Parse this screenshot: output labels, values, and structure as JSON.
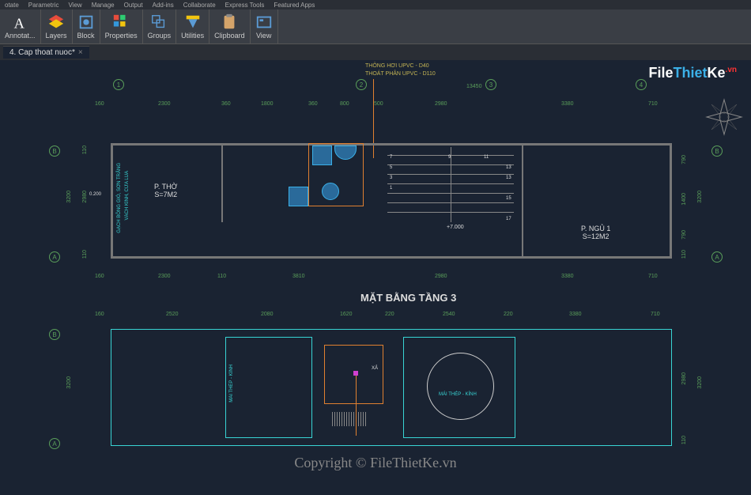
{
  "ribbon_tabs": [
    "otate",
    "Parametric",
    "View",
    "Manage",
    "Output",
    "Add-ins",
    "Collaborate",
    "Express Tools",
    "Featured Apps"
  ],
  "ribbon": {
    "annotate": "Annotat...",
    "layers": "Layers",
    "block": "Block",
    "properties": "Properties",
    "groups": "Groups",
    "utilities": "Utilities",
    "clipboard": "Clipboard",
    "view": "View"
  },
  "tab": {
    "name": "4. Cap thoat nuoc*"
  },
  "logo": {
    "file": "File",
    "thiet": "Thiet",
    "ke": "Ke",
    "vn": ".vn"
  },
  "watermark": "Copyright © FileThietKe.vn",
  "plan": {
    "header1": "THÔNG HƠI UPVC - D40",
    "header2": "THOÁT PHÂN UPVC - D110",
    "title": "MẶT BẰNG TẦNG 3",
    "grid_cols": [
      "1",
      "2",
      "3",
      "4"
    ],
    "grid_rows": [
      "B",
      "A"
    ],
    "dims_top_total": "13450",
    "dims_top": [
      "160",
      "2300",
      "360",
      "1800",
      "360",
      "800",
      "500",
      "2980",
      "3380",
      "710"
    ],
    "dims_left": [
      "110",
      "2980",
      "110",
      "3200"
    ],
    "dims_right": [
      "790",
      "1400",
      "790",
      "110",
      "3200"
    ],
    "dims_bottom": [
      "160",
      "2300",
      "110",
      "3810",
      "2980",
      "3380",
      "710"
    ],
    "dims_bottom2": [
      "160",
      "2520",
      "2080",
      "1620",
      "220",
      "2540",
      "220",
      "3380",
      "710"
    ],
    "dims_right2": [
      "2980",
      "110",
      "3200"
    ],
    "room1": "P. THỜ",
    "room1_area": "S=7M2",
    "room2_level": "+7.000",
    "room3": "P. NGỦ 1",
    "room3_area": "S=12M2",
    "stair_nums": [
      "1",
      "3",
      "3",
      "5",
      "7",
      "9",
      "11",
      "13",
      "13",
      "15",
      "17"
    ],
    "wall_note": "GẠCH BÔNG GIÓ, SƠN TRẮNG",
    "wall_note2": "VÁCH KÍNH, CỬA LÙA",
    "small_dim": "0.200",
    "roof1": "MÁI THÉP - KÍNH",
    "roof2": "MÁI THÉP - KÍNH",
    "xa_label": "XẢ"
  }
}
